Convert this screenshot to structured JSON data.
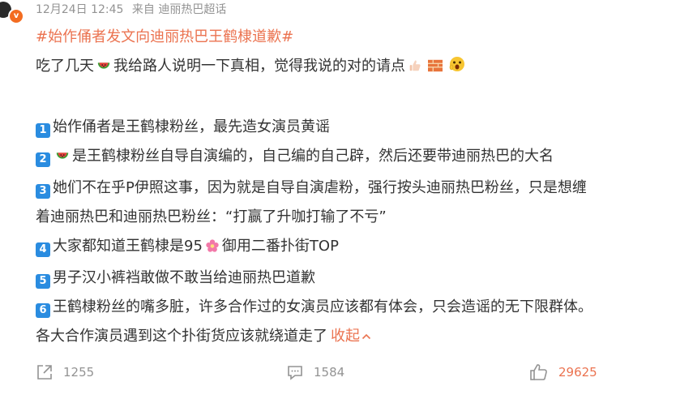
{
  "post": {
    "date": "12月24日 12:45",
    "source": "来自 迪丽热巴超话",
    "badge": "v",
    "topic": "#始作俑者发文向迪丽热巴王鹤棣道歉#",
    "intro": "吃了几天",
    "intro_rest": "我给路人说明一下真相，觉得我说的对的请点",
    "items": [
      {
        "num": "1",
        "text": "始作俑者是王鹤棣粉丝，最先造女演员黄谣"
      },
      {
        "num": "2",
        "text": "是王鹤棣粉丝自导自演编的，自己编的自己辟，然后还要带迪丽热巴的大名"
      },
      {
        "num": "3",
        "text": "她们不在乎P伊照这事，因为就是自导自演虐粉，强行按头迪丽热巴粉丝，只是想缠",
        "text2": "着迪丽热巴和迪丽热巴粉丝：“打赢了升咖打输了不亏”"
      },
      {
        "num": "4",
        "text": "大家都知道王鹤棣是95",
        "text_rest": "御用二番扑街TOP"
      },
      {
        "num": "5",
        "text": "男子汉小裤裆敢做不敢当给迪丽热巴道歉"
      },
      {
        "num": "6",
        "text": "王鹤棣粉丝的嘴多脏，许多合作过的女演员应该都有体会，只会造谣的无下限群体。",
        "text2": "各大合作演员遇到这个扑街货应该就绕道走了"
      }
    ],
    "collapse_label": "收起",
    "emojis": [
      "watermelon-icon",
      "thumbs-up-icon",
      "brick-icon",
      "shocked-face-icon",
      "flower-icon"
    ]
  },
  "actions": {
    "share_count": "1255",
    "comment_count": "1584",
    "like_count": "29625"
  },
  "colors": {
    "accent": "#eb7350",
    "number_badge": "#2a8ce0",
    "meta_text": "#939393"
  }
}
